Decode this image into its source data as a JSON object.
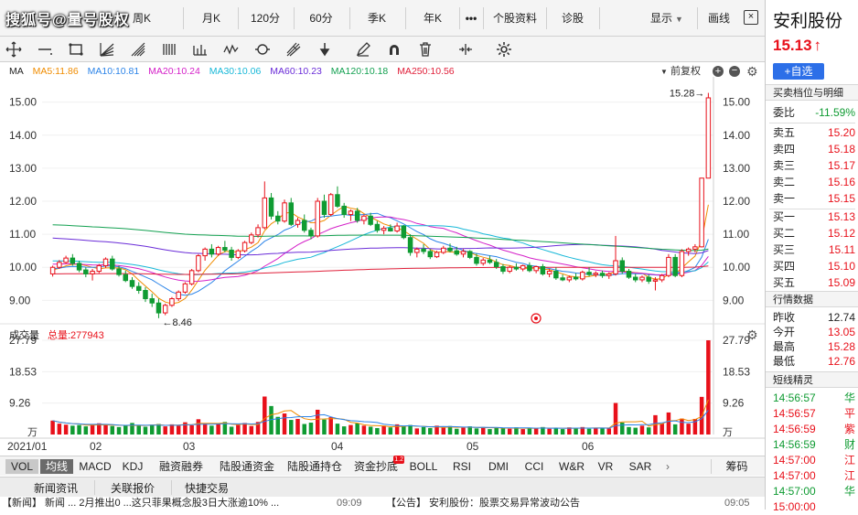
{
  "watermark": "搜狐号@量号股权",
  "period_tabs": [
    {
      "label": "周K"
    },
    {
      "label": "月K"
    },
    {
      "label": "120分"
    },
    {
      "label": "60分"
    },
    {
      "label": "季K"
    },
    {
      "label": "年K"
    }
  ],
  "more_label": "•••",
  "top_menu": {
    "profile": "个股资料",
    "diagnose": "诊股",
    "display": "显示",
    "draw": "画线",
    "close": "×"
  },
  "ma_legend": {
    "prefix": "MA",
    "items": [
      {
        "label": "MA5:11.86",
        "color": "#f08c00"
      },
      {
        "label": "MA10:10.81",
        "color": "#2c84e8"
      },
      {
        "label": "MA20:10.24",
        "color": "#d420c8"
      },
      {
        "label": "MA30:10.06",
        "color": "#18b8d8"
      },
      {
        "label": "MA60:10.23",
        "color": "#6a2cd8"
      },
      {
        "label": "MA120:10.18",
        "color": "#12a050"
      },
      {
        "label": "MA250:10.56",
        "color": "#e0203a"
      }
    ],
    "fq": "前复权"
  },
  "chart_data": {
    "type": "candlestick",
    "price_axis": {
      "ticks": [
        "15.00",
        "14.00",
        "13.00",
        "12.00",
        "11.00",
        "10.00",
        "9.00"
      ],
      "ylim": [
        8.4,
        15.6
      ]
    },
    "max_label": "15.28→",
    "min_label": "←8.46",
    "x_labels": [
      "2021/01",
      "02",
      "03",
      "04",
      "05",
      "06"
    ],
    "volume_axis": {
      "ticks": [
        "27.79",
        "18.53",
        "9.26"
      ],
      "unit": "万"
    },
    "volume_title": "成交量",
    "volume_total": "总量:277943",
    "candles": [
      [
        9.8,
        10.05,
        9.72,
        10.0
      ],
      [
        10.0,
        10.22,
        9.95,
        10.15
      ],
      [
        10.15,
        10.35,
        10.1,
        10.28
      ],
      [
        10.28,
        10.4,
        10.05,
        10.12
      ],
      [
        10.12,
        10.2,
        9.85,
        9.92
      ],
      [
        9.92,
        10.0,
        9.7,
        9.8
      ],
      [
        9.8,
        9.95,
        9.6,
        9.88
      ],
      [
        9.88,
        10.1,
        9.82,
        10.05
      ],
      [
        10.05,
        10.3,
        9.98,
        10.25
      ],
      [
        10.25,
        10.35,
        9.9,
        9.95
      ],
      [
        9.95,
        10.05,
        9.72,
        9.78
      ],
      [
        9.78,
        9.9,
        9.55,
        9.6
      ],
      [
        9.6,
        9.7,
        9.35,
        9.42
      ],
      [
        9.42,
        9.55,
        9.2,
        9.3
      ],
      [
        9.3,
        9.4,
        8.95,
        9.05
      ],
      [
        9.05,
        9.2,
        8.8,
        8.92
      ],
      [
        8.92,
        9.05,
        8.46,
        8.62
      ],
      [
        8.62,
        8.9,
        8.55,
        8.85
      ],
      [
        8.85,
        9.1,
        8.8,
        9.05
      ],
      [
        9.05,
        9.3,
        8.98,
        9.25
      ],
      [
        9.25,
        9.55,
        9.2,
        9.5
      ],
      [
        9.5,
        9.95,
        9.45,
        9.9
      ],
      [
        9.9,
        10.4,
        9.85,
        10.35
      ],
      [
        10.35,
        10.6,
        10.2,
        10.55
      ],
      [
        10.55,
        10.7,
        10.3,
        10.4
      ],
      [
        10.4,
        10.65,
        10.35,
        10.6
      ],
      [
        10.6,
        10.8,
        10.45,
        10.52
      ],
      [
        10.52,
        10.62,
        10.2,
        10.3
      ],
      [
        10.3,
        10.55,
        10.25,
        10.5
      ],
      [
        10.5,
        10.8,
        10.45,
        10.75
      ],
      [
        10.75,
        11.05,
        10.7,
        10.98
      ],
      [
        10.98,
        11.3,
        10.9,
        11.2
      ],
      [
        11.2,
        12.6,
        11.15,
        12.1
      ],
      [
        12.1,
        12.25,
        11.45,
        11.55
      ],
      [
        11.55,
        11.7,
        11.3,
        11.4
      ],
      [
        11.4,
        12.05,
        11.35,
        11.95
      ],
      [
        11.95,
        12.1,
        11.25,
        11.3
      ],
      [
        11.3,
        11.5,
        11.2,
        11.42
      ],
      [
        11.42,
        11.6,
        11.05,
        11.12
      ],
      [
        11.12,
        11.2,
        10.85,
        10.95
      ],
      [
        10.95,
        12.1,
        10.9,
        12.0
      ],
      [
        12.0,
        12.2,
        11.5,
        11.6
      ],
      [
        11.6,
        12.25,
        11.55,
        12.2
      ],
      [
        12.2,
        12.45,
        11.8,
        11.85
      ],
      [
        11.85,
        11.95,
        11.5,
        11.6
      ],
      [
        11.6,
        11.75,
        11.4,
        11.7
      ],
      [
        11.7,
        11.8,
        11.35,
        11.42
      ],
      [
        11.42,
        11.6,
        11.3,
        11.55
      ],
      [
        11.55,
        11.65,
        11.25,
        11.3
      ],
      [
        11.3,
        11.4,
        11.05,
        11.12
      ],
      [
        11.12,
        11.25,
        11.0,
        11.18
      ],
      [
        11.18,
        11.3,
        11.08,
        11.1
      ],
      [
        11.1,
        11.35,
        11.05,
        11.25
      ],
      [
        11.25,
        11.28,
        10.85,
        10.9
      ],
      [
        10.9,
        11.0,
        10.35,
        10.45
      ],
      [
        10.45,
        10.6,
        10.3,
        10.55
      ],
      [
        10.55,
        10.7,
        10.4,
        10.48
      ],
      [
        10.48,
        10.55,
        10.25,
        10.32
      ],
      [
        10.32,
        10.5,
        10.28,
        10.45
      ],
      [
        10.45,
        10.65,
        10.4,
        10.58
      ],
      [
        10.58,
        10.72,
        10.45,
        10.5
      ],
      [
        10.5,
        10.62,
        10.35,
        10.4
      ],
      [
        10.4,
        10.55,
        10.3,
        10.48
      ],
      [
        10.48,
        10.52,
        10.25,
        10.3
      ],
      [
        10.3,
        10.42,
        10.05,
        10.12
      ],
      [
        10.12,
        10.28,
        10.05,
        10.22
      ],
      [
        10.22,
        10.35,
        10.1,
        10.15
      ],
      [
        10.15,
        10.25,
        9.95,
        10.02
      ],
      [
        10.02,
        10.1,
        9.8,
        9.88
      ],
      [
        9.88,
        10.05,
        9.82,
        10.0
      ],
      [
        10.0,
        10.12,
        9.9,
        9.95
      ],
      [
        9.95,
        10.08,
        9.88,
        10.05
      ],
      [
        10.05,
        10.15,
        9.85,
        9.9
      ],
      [
        9.9,
        10.05,
        9.82,
        10.02
      ],
      [
        10.02,
        10.1,
        9.75,
        9.8
      ],
      [
        9.8,
        9.95,
        9.7,
        9.88
      ],
      [
        9.88,
        10.0,
        9.62,
        9.68
      ],
      [
        9.68,
        9.78,
        9.58,
        9.62
      ],
      [
        9.62,
        9.75,
        9.55,
        9.7
      ],
      [
        9.7,
        9.82,
        9.6,
        9.65
      ],
      [
        9.65,
        9.9,
        9.6,
        9.85
      ],
      [
        9.85,
        10.0,
        9.72,
        9.78
      ],
      [
        9.78,
        9.88,
        9.7,
        9.82
      ],
      [
        9.82,
        9.9,
        9.68,
        9.75
      ],
      [
        9.75,
        9.85,
        9.65,
        9.8
      ],
      [
        9.8,
        10.95,
        9.75,
        10.2
      ],
      [
        10.2,
        10.3,
        9.8,
        9.88
      ],
      [
        9.88,
        9.95,
        9.65,
        9.7
      ],
      [
        9.7,
        9.8,
        9.55,
        9.62
      ],
      [
        9.62,
        9.75,
        9.55,
        9.7
      ],
      [
        9.7,
        9.78,
        9.5,
        9.58
      ],
      [
        9.58,
        9.7,
        9.3,
        9.62
      ],
      [
        9.62,
        9.8,
        9.55,
        9.75
      ],
      [
        9.75,
        10.4,
        9.7,
        10.3
      ],
      [
        10.3,
        10.4,
        9.7,
        9.75
      ],
      [
        9.75,
        10.55,
        9.7,
        10.48
      ],
      [
        10.48,
        10.6,
        10.35,
        10.55
      ],
      [
        10.55,
        10.7,
        10.45,
        10.62
      ],
      [
        10.62,
        12.7,
        10.6,
        12.7
      ],
      [
        12.7,
        15.28,
        12.75,
        15.13
      ]
    ],
    "volumes": [
      4.1,
      3.2,
      2.9,
      2.6,
      2.8,
      2.4,
      3.0,
      3.3,
      2.7,
      2.5,
      2.2,
      2.6,
      3.4,
      2.8,
      2.3,
      2.9,
      3.1,
      2.4,
      3.0,
      2.6,
      3.6,
      2.7,
      4.5,
      3.2,
      2.6,
      3.3,
      3.7,
      2.3,
      2.8,
      3.4,
      2.5,
      3.7,
      11.2,
      8.4,
      5.2,
      6.2,
      4.3,
      4.6,
      3.1,
      3.5,
      7.3,
      4.4,
      5.1,
      3.2,
      2.4,
      2.8,
      3.3,
      2.6,
      2.3,
      1.9,
      2.6,
      2.1,
      3.0,
      2.4,
      2.8,
      1.8,
      2.2,
      1.9,
      2.6,
      2.0,
      2.5,
      1.7,
      2.0,
      2.4,
      1.8,
      2.2,
      1.6,
      2.0,
      1.9,
      1.7,
      2.1,
      1.6,
      2.0,
      1.8,
      2.2,
      1.7,
      1.9,
      1.6,
      2.1,
      1.8,
      2.2,
      1.7,
      1.9,
      2.0,
      1.8,
      9.3,
      3.5,
      2.2,
      2.0,
      2.6,
      2.1,
      5.7,
      3.2,
      6.5,
      3.0,
      4.7,
      3.2,
      4.6,
      11.1,
      27.79
    ]
  },
  "sub_tabs": [
    {
      "label": "VOL"
    },
    {
      "label": "均线"
    },
    {
      "label": "MACD"
    },
    {
      "label": "KDJ"
    },
    {
      "label": "融资融券"
    },
    {
      "label": "陆股通资金"
    },
    {
      "label": "陆股通持仓"
    },
    {
      "label": "资金抄底"
    },
    {
      "label": "BOLL"
    },
    {
      "label": "RSI"
    },
    {
      "label": "DMI"
    },
    {
      "label": "CCI"
    },
    {
      "label": "W&R"
    },
    {
      "label": "VR"
    },
    {
      "label": "SAR"
    }
  ],
  "sub_tab_badge": "1.2",
  "chips_label": "筹码",
  "news_tabs": [
    {
      "label": "新闻资讯"
    },
    {
      "label": "关联报价"
    },
    {
      "label": "快捷交易"
    }
  ],
  "ticker": {
    "left": "【新闻】 新闻 ... 2月推出0 ...这只菲果概念股3日大涨逾10% ...",
    "left_time": "09:09",
    "right": "【公告】 安利股份：股票交易异常波动公告",
    "right_time": "09:05"
  },
  "stock": {
    "name": "安利股份",
    "price": "15.13",
    "arrow": "↑",
    "add_watch": "+自选"
  },
  "order_book": {
    "title": "买卖档位与明细",
    "ratio_label": "委比",
    "ratio_value": "-11.59%",
    "asks": [
      {
        "label": "卖五",
        "price": "15.20"
      },
      {
        "label": "卖四",
        "price": "15.18"
      },
      {
        "label": "卖三",
        "price": "15.17"
      },
      {
        "label": "卖二",
        "price": "15.16"
      },
      {
        "label": "卖一",
        "price": "15.15"
      }
    ],
    "bids": [
      {
        "label": "买一",
        "price": "15.13"
      },
      {
        "label": "买二",
        "price": "15.12"
      },
      {
        "label": "买三",
        "price": "15.11"
      },
      {
        "label": "买四",
        "price": "15.10"
      },
      {
        "label": "买五",
        "price": "15.09"
      }
    ]
  },
  "quote": {
    "title": "行情数据",
    "rows": [
      {
        "label": "昨收",
        "value": "12.74",
        "color": "#222222"
      },
      {
        "label": "今开",
        "value": "13.05",
        "color": "#e8101a"
      },
      {
        "label": "最高",
        "value": "15.28",
        "color": "#e8101a"
      },
      {
        "label": "最低",
        "value": "12.76",
        "color": "#e8101a"
      }
    ]
  },
  "ticks": {
    "title": "短线精灵",
    "rows": [
      {
        "time": "14:56:57",
        "text": "华",
        "color": "#0f9b32"
      },
      {
        "time": "14:56:57",
        "text": "平",
        "color": "#e8101a"
      },
      {
        "time": "14:56:59",
        "text": "紫",
        "color": "#e8101a"
      },
      {
        "time": "14:56:59",
        "text": "财",
        "color": "#0f9b32"
      },
      {
        "time": "14:57:00",
        "text": "江",
        "color": "#e8101a"
      },
      {
        "time": "14:57:00",
        "text": "江",
        "color": "#e8101a"
      },
      {
        "time": "14:57:00",
        "text": "华",
        "color": "#0f9b32"
      },
      {
        "time": "15:00:00",
        "text": "",
        "color": "#e8101a"
      }
    ]
  }
}
